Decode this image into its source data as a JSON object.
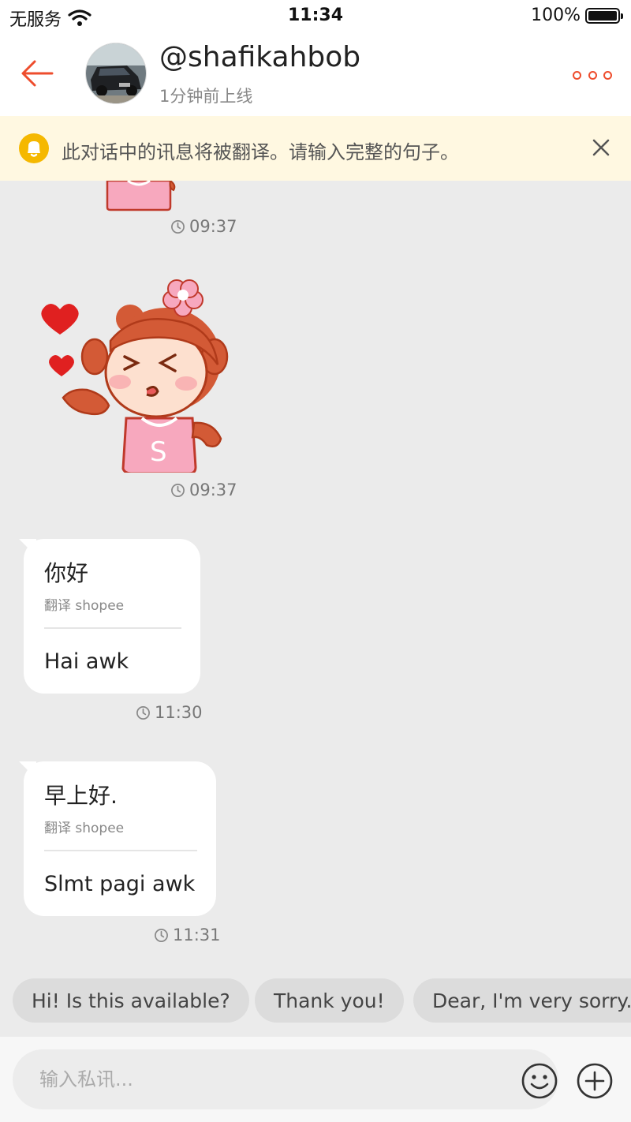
{
  "status_bar": {
    "carrier": "无服务",
    "time": "11:34",
    "battery": "100%",
    "battery_level": 1.0
  },
  "header": {
    "username": "@shafikahbob",
    "status": "1分钟前上线"
  },
  "notice": {
    "text": "此对话中的讯息将被翻译。请输入完整的句子。"
  },
  "messages": [
    {
      "type": "sticker",
      "time": "09:37"
    },
    {
      "type": "sticker",
      "sticker_letter": "S",
      "time": "09:37"
    },
    {
      "type": "text",
      "original": "你好",
      "translated_by": "翻译 shopee",
      "translated": "Hai awk",
      "time": "11:30"
    },
    {
      "type": "text",
      "original": "早上好.",
      "translated_by": "翻译 shopee",
      "translated": "Slmt pagi awk",
      "time": "11:31"
    }
  ],
  "quick_replies": [
    "Hi! Is this available?",
    "Thank you!",
    "Dear, I'm very sorry.."
  ],
  "input": {
    "placeholder": "输入私讯...",
    "value": ""
  },
  "colors": {
    "accent": "#ee4d2d",
    "notice_bg": "#fff8e1",
    "bell": "#f5b800"
  },
  "icons": [
    "wifi-icon",
    "battery-icon",
    "back-arrow-icon",
    "more-icon",
    "bell-icon",
    "close-icon",
    "clock-icon",
    "emoji-icon",
    "plus-icon"
  ]
}
